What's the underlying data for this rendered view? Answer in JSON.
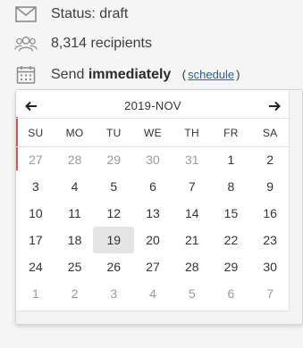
{
  "status": {
    "text": "Status: draft",
    "icon": "envelope-icon"
  },
  "recipients": {
    "text": "8,314 recipients",
    "icon": "users-icon"
  },
  "send": {
    "prefix": "Send",
    "mode": "immediately",
    "paren_open": "(",
    "schedule_label": "schedule",
    "paren_close": ")",
    "icon": "calendar-icon"
  },
  "datepicker": {
    "title": "2019-NOV",
    "prev_icon": "arrow-left-icon",
    "next_icon": "arrow-right-icon",
    "weekdays": [
      "SU",
      "MO",
      "TU",
      "WE",
      "TH",
      "FR",
      "SA"
    ],
    "weeks": [
      [
        {
          "d": "27",
          "m": true
        },
        {
          "d": "28",
          "m": true
        },
        {
          "d": "29",
          "m": true
        },
        {
          "d": "30",
          "m": true
        },
        {
          "d": "31",
          "m": true
        },
        {
          "d": "1"
        },
        {
          "d": "2"
        }
      ],
      [
        {
          "d": "3"
        },
        {
          "d": "4"
        },
        {
          "d": "5"
        },
        {
          "d": "6"
        },
        {
          "d": "7"
        },
        {
          "d": "8"
        },
        {
          "d": "9"
        }
      ],
      [
        {
          "d": "10"
        },
        {
          "d": "11"
        },
        {
          "d": "12"
        },
        {
          "d": "13"
        },
        {
          "d": "14"
        },
        {
          "d": "15"
        },
        {
          "d": "16"
        }
      ],
      [
        {
          "d": "17"
        },
        {
          "d": "18"
        },
        {
          "d": "19",
          "s": true
        },
        {
          "d": "20"
        },
        {
          "d": "21"
        },
        {
          "d": "22"
        },
        {
          "d": "23"
        }
      ],
      [
        {
          "d": "24"
        },
        {
          "d": "25"
        },
        {
          "d": "26"
        },
        {
          "d": "27"
        },
        {
          "d": "28"
        },
        {
          "d": "29"
        },
        {
          "d": "30"
        }
      ],
      [
        {
          "d": "1",
          "m": true
        },
        {
          "d": "2",
          "m": true
        },
        {
          "d": "3",
          "m": true
        },
        {
          "d": "4",
          "m": true
        },
        {
          "d": "5",
          "m": true
        },
        {
          "d": "6",
          "m": true
        },
        {
          "d": "7",
          "m": true
        }
      ]
    ],
    "selected_color": "#e4e4e4"
  }
}
